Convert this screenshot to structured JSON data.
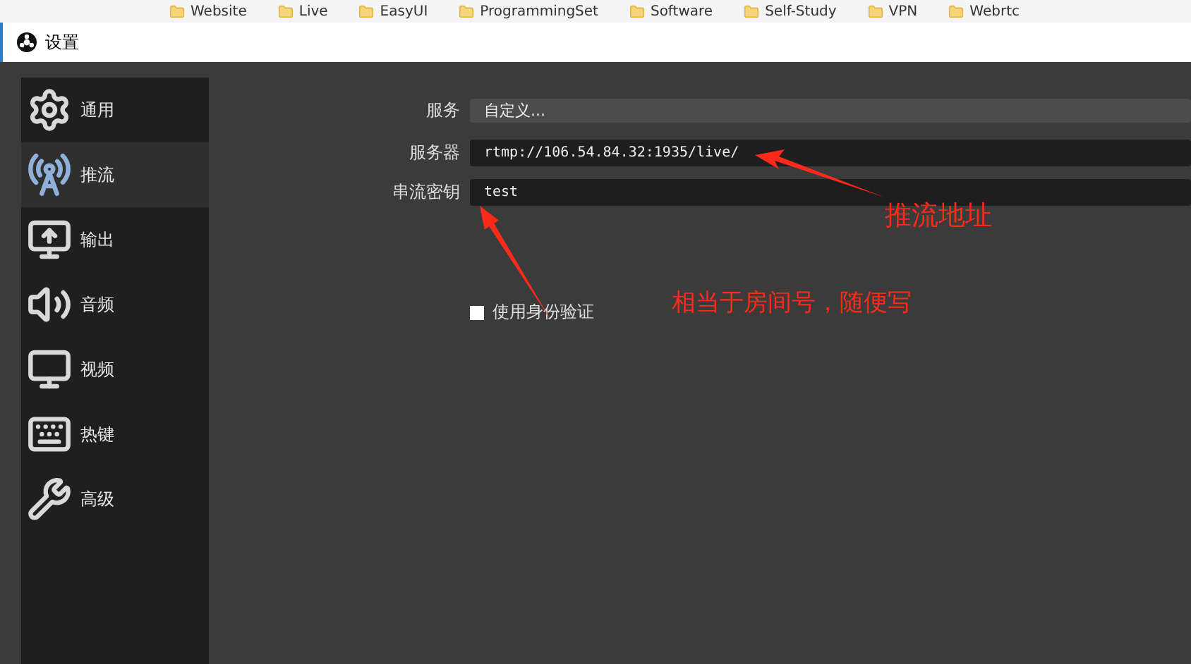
{
  "bookmarks": [
    "Website",
    "Live",
    "EasyUI",
    "ProgrammingSet",
    "Software",
    "Self-Study",
    "VPN",
    "Webrtc"
  ],
  "window": {
    "title": "设置"
  },
  "sidebar": {
    "items": [
      {
        "label": "通用",
        "kind": "gear",
        "selected": false
      },
      {
        "label": "推流",
        "kind": "tower",
        "selected": true
      },
      {
        "label": "输出",
        "kind": "output",
        "selected": false
      },
      {
        "label": "音频",
        "kind": "audio",
        "selected": false
      },
      {
        "label": "视频",
        "kind": "video",
        "selected": false
      },
      {
        "label": "热键",
        "kind": "keyboard",
        "selected": false
      },
      {
        "label": "高级",
        "kind": "tools",
        "selected": false
      }
    ]
  },
  "form": {
    "service": {
      "label": "服务",
      "value": "自定义..."
    },
    "server": {
      "label": "服务器",
      "value": "rtmp://106.54.84.32:1935/live/"
    },
    "stream_key": {
      "label": "串流密钥",
      "value": "test"
    },
    "auth": {
      "label": "使用身份验证",
      "checked": false
    }
  },
  "annotations": [
    {
      "text": "推流地址"
    },
    {
      "text": "相当于房间号，随便写"
    }
  ]
}
